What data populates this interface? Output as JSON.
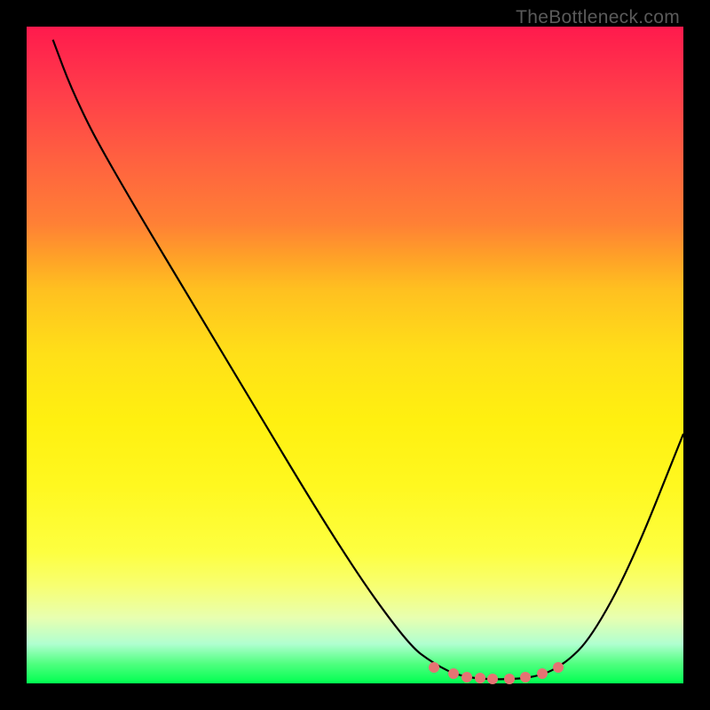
{
  "watermark": "TheBottleneck.com",
  "chart_data": {
    "type": "line",
    "title": "",
    "xlabel": "",
    "ylabel": "",
    "xlim": [
      0,
      100
    ],
    "ylim": [
      0,
      100
    ],
    "curve_points": [
      {
        "x": 4,
        "y": 2
      },
      {
        "x": 7,
        "y": 10
      },
      {
        "x": 12,
        "y": 20
      },
      {
        "x": 30,
        "y": 50
      },
      {
        "x": 48,
        "y": 80
      },
      {
        "x": 58,
        "y": 94
      },
      {
        "x": 62,
        "y": 97
      },
      {
        "x": 66,
        "y": 99
      },
      {
        "x": 72,
        "y": 99.5
      },
      {
        "x": 78,
        "y": 99
      },
      {
        "x": 82,
        "y": 97
      },
      {
        "x": 86,
        "y": 93
      },
      {
        "x": 92,
        "y": 82
      },
      {
        "x": 100,
        "y": 62
      }
    ],
    "markers": [
      {
        "x": 62,
        "y": 97.5
      },
      {
        "x": 65,
        "y": 98.5
      },
      {
        "x": 67,
        "y": 99
      },
      {
        "x": 69,
        "y": 99.2
      },
      {
        "x": 71,
        "y": 99.3
      },
      {
        "x": 73.5,
        "y": 99.3
      },
      {
        "x": 76,
        "y": 99
      },
      {
        "x": 78.5,
        "y": 98.5
      },
      {
        "x": 81,
        "y": 97.5
      }
    ],
    "background_gradient": {
      "top": "#ff1a4d",
      "middle": "#ffe018",
      "bottom": "#00ff50"
    },
    "marker_color": "#e57373",
    "curve_color": "#000000"
  }
}
